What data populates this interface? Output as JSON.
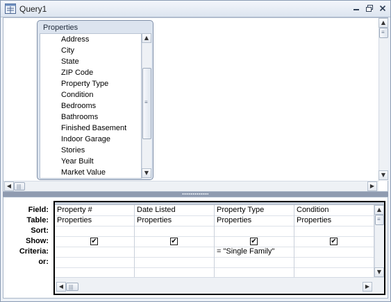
{
  "window": {
    "title": "Query1",
    "minimize_label": "▭",
    "restore_label": "❐",
    "close_label": "✕"
  },
  "field_list": {
    "table_name": "Properties",
    "fields": [
      "Address",
      "City",
      "State",
      "ZIP Code",
      "Property Type",
      "Condition",
      "Bedrooms",
      "Bathrooms",
      "Finished Basement",
      "Indoor Garage",
      "Stories",
      "Year Built",
      "Market Value"
    ]
  },
  "design_grid": {
    "row_labels": {
      "field": "Field:",
      "table": "Table:",
      "sort": "Sort:",
      "show": "Show:",
      "criteria": "Criteria:",
      "or": "or:"
    },
    "columns": [
      {
        "field": "Property #",
        "table": "Properties",
        "sort": "",
        "show": true,
        "criteria": "",
        "or": ""
      },
      {
        "field": "Date Listed",
        "table": "Properties",
        "sort": "",
        "show": true,
        "criteria": "",
        "or": ""
      },
      {
        "field": "Property Type",
        "table": "Properties",
        "sort": "",
        "show": true,
        "criteria": "= \"Single Family\"",
        "or": ""
      },
      {
        "field": "Condition",
        "table": "Properties",
        "sort": "",
        "show": true,
        "criteria": "",
        "or": ""
      }
    ]
  },
  "scroll": {
    "up_arrow": "▲",
    "down_arrow": "▼",
    "left_arrow": "◀",
    "right_arrow": "▶",
    "grip": "≡",
    "hgrip": "|||"
  },
  "icons": {
    "window_icon": "query-icon",
    "checkmark": "✔"
  },
  "colors": {
    "splitter": "#8f9bb0",
    "table_box": "#dce4ef"
  }
}
